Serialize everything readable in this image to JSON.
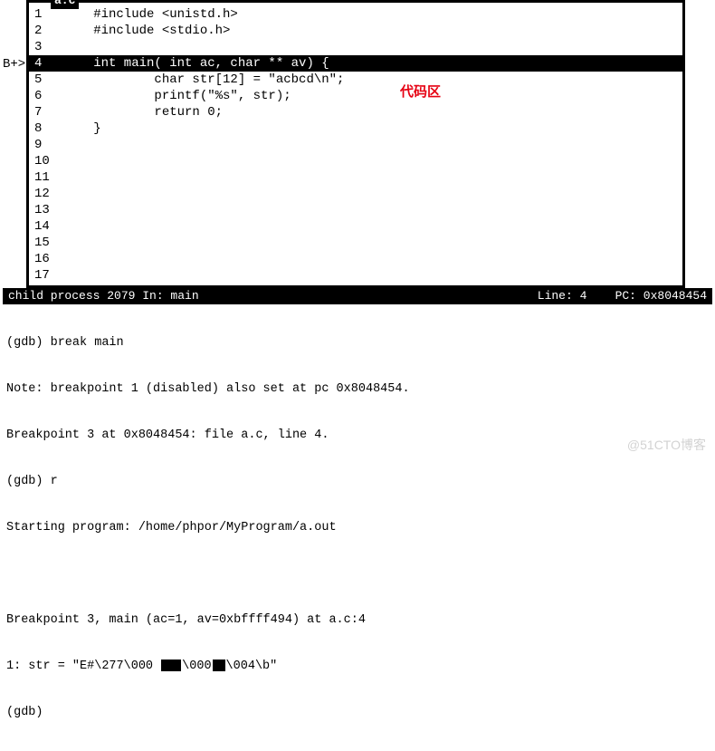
{
  "source_pane": {
    "filename": "a.c",
    "breakpoint_marker": "B+>",
    "breakpoint_line": 4,
    "highlighted_line": 4,
    "lines": [
      {
        "n": "1",
        "text": "   #include <unistd.h>"
      },
      {
        "n": "2",
        "text": "   #include <stdio.h>"
      },
      {
        "n": "3",
        "text": ""
      },
      {
        "n": "4",
        "text": "   int main( int ac, char ** av) {"
      },
      {
        "n": "5",
        "text": "           char str[12] = \"acbcd\\n\";"
      },
      {
        "n": "6",
        "text": "           printf(\"%s\", str);"
      },
      {
        "n": "7",
        "text": "           return 0;"
      },
      {
        "n": "8",
        "text": "   }"
      },
      {
        "n": "9",
        "text": ""
      },
      {
        "n": "10",
        "text": ""
      },
      {
        "n": "11",
        "text": ""
      },
      {
        "n": "12",
        "text": ""
      },
      {
        "n": "13",
        "text": ""
      },
      {
        "n": "14",
        "text": ""
      },
      {
        "n": "15",
        "text": ""
      },
      {
        "n": "16",
        "text": ""
      },
      {
        "n": "17",
        "text": ""
      }
    ],
    "annotation": "代码区"
  },
  "status": {
    "left": "child process 2079 In: main",
    "right": "Line: 4    PC: 0x8048454"
  },
  "console": {
    "l0": "(gdb) break main",
    "l1": "Note: breakpoint 1 (disabled) also set at pc 0x8048454.",
    "l2": "Breakpoint 3 at 0x8048454: file a.c, line 4.",
    "l3": "(gdb) r",
    "l4": "Starting program: /home/phpor/MyProgram/a.out",
    "l5": "",
    "l6": "Breakpoint 3, main (ac=1, av=0xbffff494) at a.c:4",
    "l7a": "1: str = \"E#\\277\\000 ",
    "l7b": "\\000",
    "l7c": "\\004\\b\"",
    "l8": "(gdb)"
  },
  "watermark": "@51CTO博客"
}
